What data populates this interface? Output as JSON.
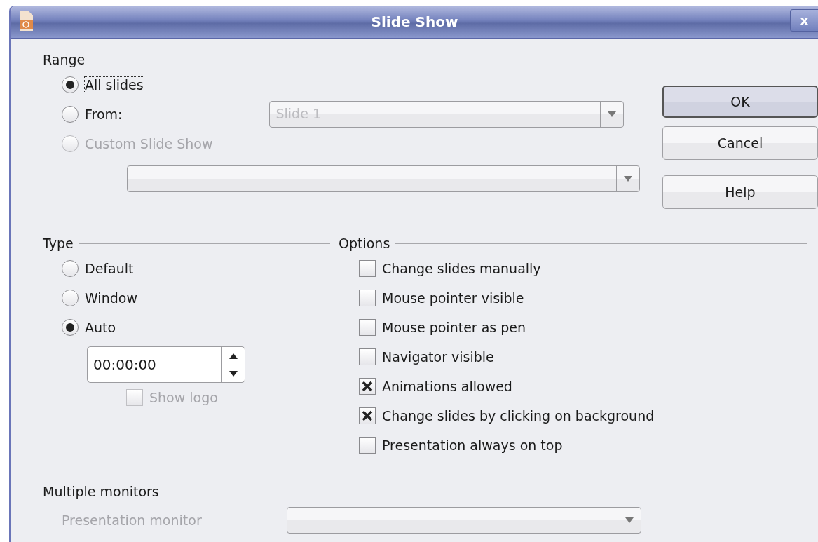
{
  "window": {
    "title": "Slide Show",
    "close": "x"
  },
  "range": {
    "label": "Range",
    "options": [
      {
        "label": "All slides",
        "selected": true,
        "disabled": false,
        "focused": true
      },
      {
        "label": "From:",
        "selected": false,
        "disabled": false,
        "focused": false
      },
      {
        "label": "Custom Slide Show",
        "selected": false,
        "disabled": true,
        "focused": false
      }
    ],
    "from_slide": {
      "value": "Slide 1",
      "disabled": true
    }
  },
  "buttons": [
    {
      "label": "OK",
      "default": true
    },
    {
      "label": "Cancel",
      "default": false
    },
    {
      "label": "Help",
      "default": false
    }
  ],
  "type": {
    "label": "Type",
    "options": [
      {
        "label": "Default",
        "selected": false
      },
      {
        "label": "Window",
        "selected": false
      },
      {
        "label": "Auto",
        "selected": true
      }
    ],
    "auto_time": "00:00:00",
    "show_logo": {
      "label": "Show logo",
      "checked": false,
      "disabled": true
    }
  },
  "options": {
    "label": "Options",
    "items": [
      {
        "label": "Change slides manually",
        "checked": false
      },
      {
        "label": "Mouse pointer visible",
        "checked": false
      },
      {
        "label": "Mouse pointer as pen",
        "checked": false
      },
      {
        "label": "Navigator visible",
        "checked": false
      },
      {
        "label": "Animations allowed",
        "checked": true
      },
      {
        "label": "Change slides by clicking on background",
        "checked": true
      },
      {
        "label": "Presentation always on top",
        "checked": false
      }
    ]
  },
  "monitors": {
    "label": "Multiple monitors",
    "presentation_monitor": {
      "label": "Presentation monitor",
      "disabled": true
    }
  }
}
